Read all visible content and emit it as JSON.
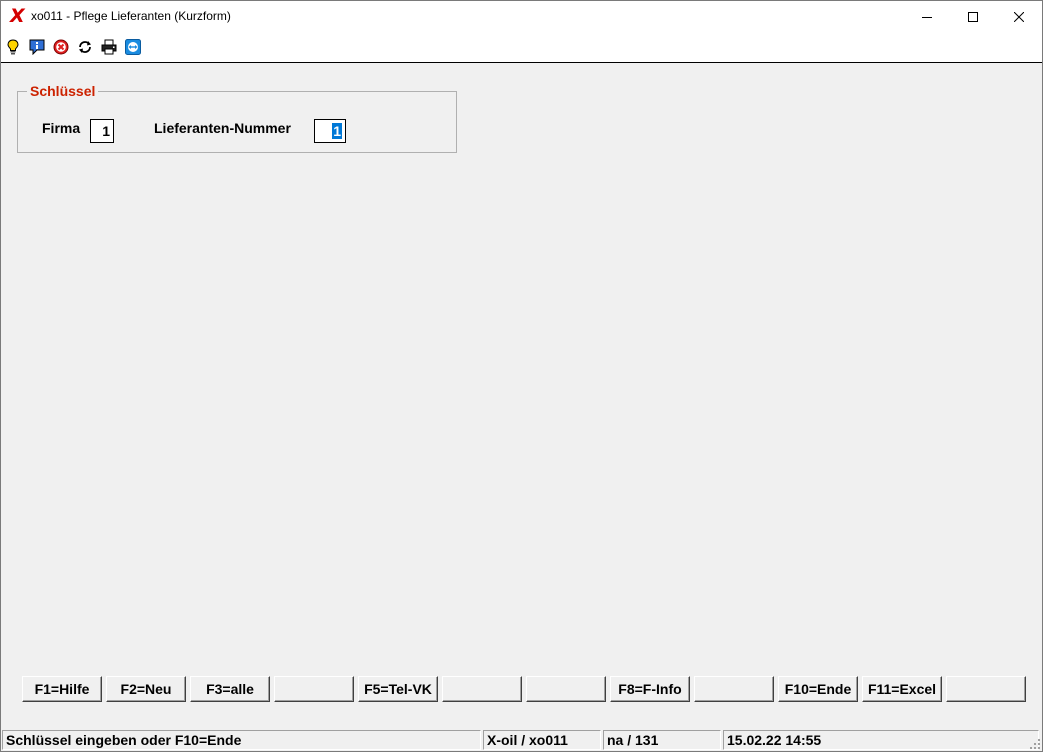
{
  "window": {
    "title": "xo011 - Pflege Lieferanten (Kurzform)",
    "logo_letter": "X",
    "accent_color": "#d40000"
  },
  "toolbar": {
    "icons": [
      "lightbulb-icon",
      "info-icon",
      "cancel-icon",
      "refresh-icon",
      "printer-icon",
      "teamviewer-icon"
    ]
  },
  "key_group": {
    "legend": "Schlüssel",
    "legend_color": "#cc2200",
    "firma_label": "Firma",
    "firma_value": "1",
    "lieferant_label": "Lieferanten-Nummer",
    "lieferant_value": "1"
  },
  "function_keys": [
    {
      "label": "F1=Hilfe"
    },
    {
      "label": "F2=Neu"
    },
    {
      "label": "F3=alle"
    },
    {
      "label": ""
    },
    {
      "label": "F5=Tel-VK"
    },
    {
      "label": ""
    },
    {
      "label": ""
    },
    {
      "label": "F8=F-Info"
    },
    {
      "label": ""
    },
    {
      "label": "F10=Ende"
    },
    {
      "label": "F11=Excel"
    },
    {
      "label": ""
    }
  ],
  "status": {
    "message": "Schlüssel eingeben oder F10=Ende",
    "program": "X-oil / xo011",
    "user": "na / 131",
    "datetime": "15.02.22 14:55"
  }
}
